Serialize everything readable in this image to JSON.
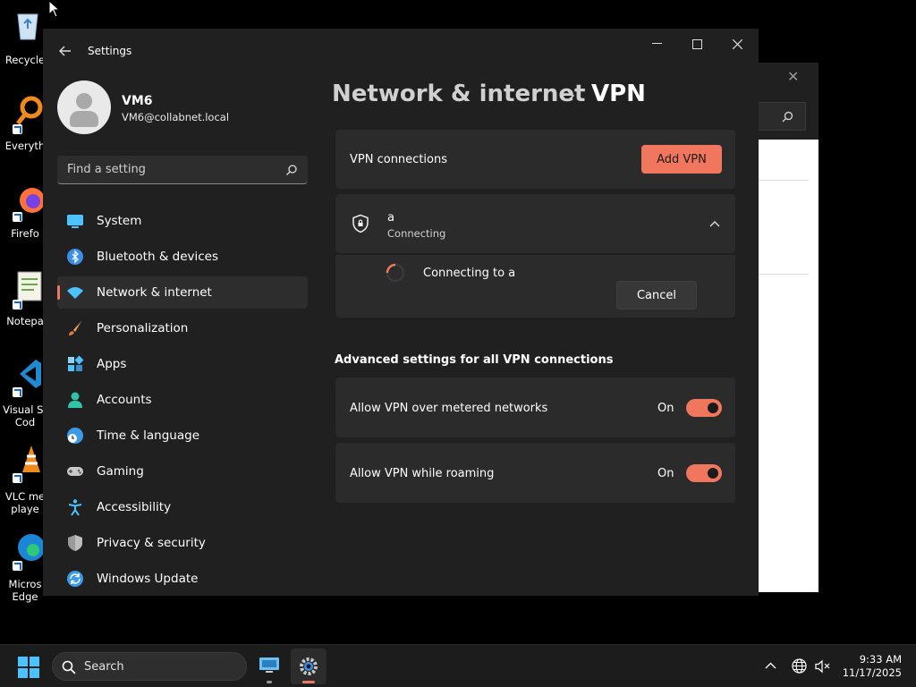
{
  "desktop": {
    "icons": [
      {
        "label": "Recycle"
      },
      {
        "label": "Everyth"
      },
      {
        "label": "Firefo"
      },
      {
        "label": "Notepa"
      },
      {
        "label_line1": "Visual St",
        "label_line2": "Cod"
      },
      {
        "label_line1": "VLC me",
        "label_line2": "playe"
      },
      {
        "label_line1": "Micros",
        "label_line2": "Edge"
      }
    ]
  },
  "window": {
    "title": "Settings",
    "controls": {
      "minimize": "minimize-icon",
      "maximize": "maximize-icon",
      "close": "close-icon"
    }
  },
  "user": {
    "name": "VM6",
    "email": "VM6@collabnet.local"
  },
  "search": {
    "placeholder": "Find a setting"
  },
  "nav": {
    "items": [
      {
        "label": "System",
        "icon": "system-icon"
      },
      {
        "label": "Bluetooth & devices",
        "icon": "bluetooth-icon"
      },
      {
        "label": "Network & internet",
        "icon": "wifi-icon",
        "active": true
      },
      {
        "label": "Personalization",
        "icon": "brush-icon"
      },
      {
        "label": "Apps",
        "icon": "apps-icon"
      },
      {
        "label": "Accounts",
        "icon": "accounts-icon"
      },
      {
        "label": "Time & language",
        "icon": "globe-clock-icon"
      },
      {
        "label": "Gaming",
        "icon": "gamepad-icon"
      },
      {
        "label": "Accessibility",
        "icon": "accessibility-icon"
      },
      {
        "label": "Privacy & security",
        "icon": "shield-icon"
      },
      {
        "label": "Windows Update",
        "icon": "update-icon"
      }
    ]
  },
  "breadcrumb": {
    "parent": "Network & internet",
    "current": "VPN"
  },
  "vpn": {
    "connections_label": "VPN connections",
    "add_button": "Add VPN",
    "connection": {
      "name": "a",
      "status": "Connecting",
      "progress_text": "Connecting to a",
      "cancel_button": "Cancel"
    }
  },
  "advanced": {
    "title": "Advanced settings for all VPN connections",
    "metered": {
      "label": "Allow VPN over metered networks",
      "state": "On",
      "enabled": true
    },
    "roaming": {
      "label": "Allow VPN while roaming",
      "state": "On",
      "enabled": true
    }
  },
  "taskbar": {
    "search_label": "Search",
    "time": "9:33 AM",
    "date": "11/17/2025"
  },
  "colors": {
    "accent": "#f0765e",
    "window_bg": "#202020",
    "card_bg": "#2b2b2b"
  }
}
